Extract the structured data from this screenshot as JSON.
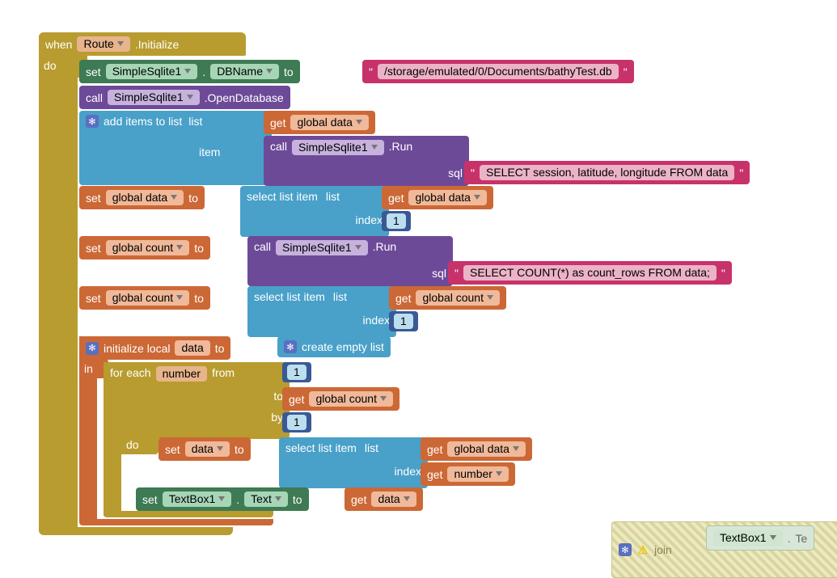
{
  "event": {
    "when": "when",
    "component": "Route",
    "method": ".Initialize",
    "do": "do"
  },
  "set_dbname": {
    "set": "set",
    "comp": "SimpleSqlite1",
    "dot": ".",
    "prop": "DBName",
    "to": "to",
    "q1": "\"",
    "val": "/storage/emulated/0/Documents/bathyTest.db",
    "q2": "\""
  },
  "call_open": {
    "call": "call",
    "comp": "SimpleSqlite1",
    "method": ".OpenDatabase"
  },
  "add_items": {
    "label": "add items to list",
    "list": "list",
    "item": "item",
    "get": "get",
    "var": "global data",
    "call": "call",
    "comp": "SimpleSqlite1",
    "method": ".Run",
    "sqlLabel": "sql",
    "q1": "\"",
    "sql": "SELECT session, latitude, longitude FROM data",
    "q2": "\""
  },
  "set_gdata": {
    "set": "set",
    "var": "global data",
    "to": "to",
    "sel": "select list item",
    "list": "list",
    "get": "get",
    "gvar": "global data",
    "index": "index",
    "idx": "1"
  },
  "set_gcount_run": {
    "set": "set",
    "var": "global count",
    "to": "to",
    "call": "call",
    "comp": "SimpleSqlite1",
    "method": ".Run",
    "sqlLabel": "sql",
    "q1": "\"",
    "sql": "SELECT COUNT(*) as count_rows FROM data;",
    "q2": "\""
  },
  "set_gcount_sel": {
    "set": "set",
    "var": "global count",
    "to": "to",
    "sel": "select list item",
    "list": "list",
    "get": "get",
    "gvar": "global count",
    "index": "index",
    "idx": "1"
  },
  "init_local": {
    "init": "initialize local",
    "var": "data",
    "to": "to",
    "create": "create empty list",
    "in": "in"
  },
  "foreach": {
    "for": "for each",
    "var": "number",
    "from": "from",
    "f": "1",
    "to": "to",
    "get": "get",
    "gvar": "global count",
    "by": "by",
    "b": "1",
    "do": "do"
  },
  "inner_set_data": {
    "set": "set",
    "var": "data",
    "to": "to",
    "sel": "select list item",
    "list": "list",
    "get1": "get",
    "gvar": "global data",
    "index": "index",
    "get2": "get",
    "nvar": "number"
  },
  "set_textbox": {
    "set": "set",
    "comp": "TextBox1",
    "dot": ".",
    "prop": "Text",
    "to": "to",
    "get": "get",
    "var": "data"
  },
  "bottom": {
    "join": "join",
    "comp": "TextBox1",
    "dot": ".",
    "tail": "Te"
  }
}
